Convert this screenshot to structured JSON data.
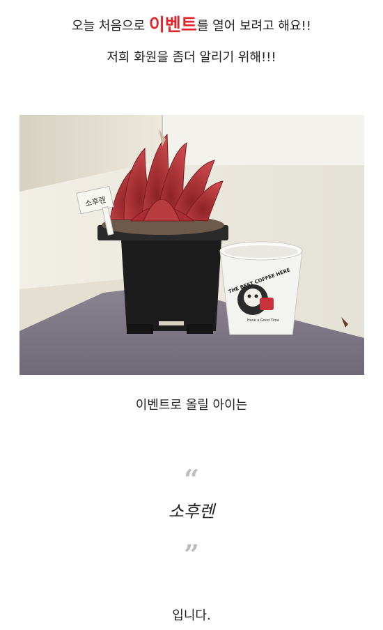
{
  "intro": {
    "line1_before": "오늘 처음으로 ",
    "line1_highlight": "이벤트",
    "line1_after": "를 열어 보려고 해요!!",
    "line2": "저희 화원을 좀더 알리기 위해!!!"
  },
  "photo": {
    "tag_text": "소후렌",
    "cup_text": "THE BEST COFFEE HERE",
    "cup_sub": "Have a Good Time",
    "colors": {
      "leaf": "#b5363b",
      "pot": "#1c1c1c",
      "wall": "#e9e6da",
      "floor": "#7d7785"
    }
  },
  "caption": "이벤트로 올릴 아이는",
  "quote": {
    "open": "“",
    "close": "”",
    "name": "소후렌"
  },
  "ending": "입니다.",
  "colors": {
    "highlight": "#e0262c",
    "quote": "#bdbdbd",
    "text": "#222222"
  }
}
